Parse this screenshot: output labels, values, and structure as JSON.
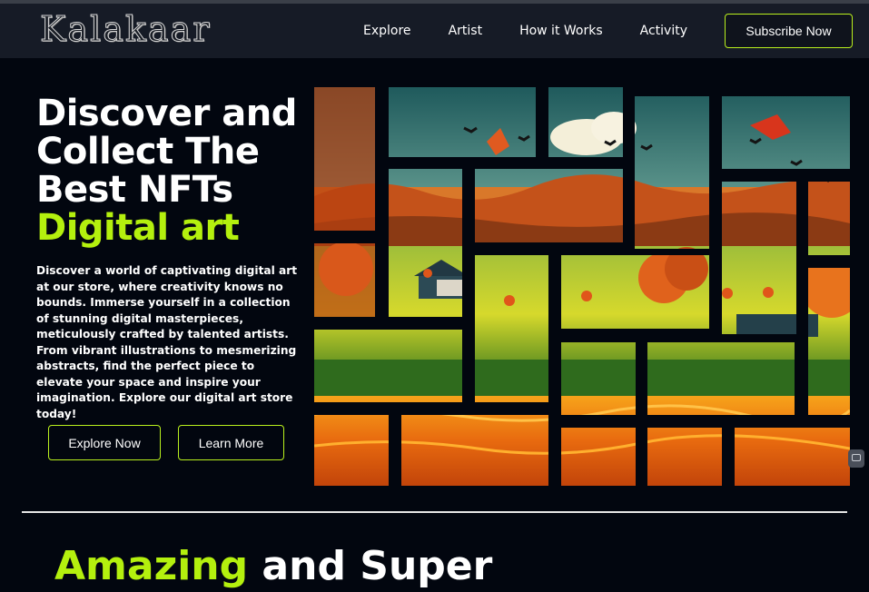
{
  "brand": {
    "logo_text": "Kalakaar"
  },
  "nav": {
    "links": [
      "Explore",
      "Artist",
      "How it Works",
      "Activity"
    ],
    "subscribe_label": "Subscribe Now"
  },
  "hero": {
    "title_lines": [
      "Discover and",
      "Collect The",
      "Best NFTs"
    ],
    "title_accent": "Digital art",
    "description": "Discover a world of captivating digital art at our store, where creativity knows no bounds. Immerse yourself in a collection of stunning digital masterpieces, meticulously crafted by talented artists. From vibrant illustrations to mesmerizing abstracts, find the perfect piece to elevate your space and inspire your imagination. Explore our digital art store today!",
    "explore_label": "Explore Now",
    "learn_label": "Learn More"
  },
  "section": {
    "title_accent": "Amazing",
    "title_rest": " and Super"
  },
  "colors": {
    "accent": "#b4f00e",
    "background": "#02060f",
    "navbar": "#161b26"
  },
  "icons": {
    "side_widget": "chat-bot-icon"
  }
}
